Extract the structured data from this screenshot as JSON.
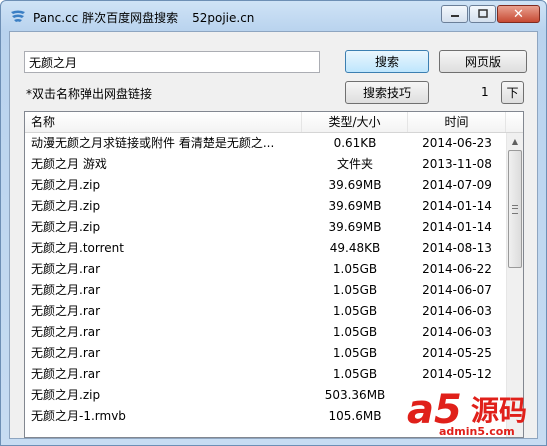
{
  "window": {
    "title": "Panc.cc 胖次百度网盘搜索",
    "subtitle": "52pojie.cn",
    "minimize_icon": "minimize-icon",
    "maximize_icon": "maximize-icon",
    "close_icon": "close-icon"
  },
  "search": {
    "value": "无颜之月",
    "search_button": "搜索",
    "web_button": "网页版",
    "tips_button": "搜索技巧",
    "hint": "*双击名称弹出网盘链接",
    "page": "1",
    "next_button": "下"
  },
  "table": {
    "headers": {
      "name": "名称",
      "type": "类型/大小",
      "time": "时间"
    },
    "rows": [
      {
        "name": "动漫无颜之月求链接或附件 看清楚是无颜之...",
        "size": "0.61KB",
        "time": "2014-06-23"
      },
      {
        "name": "无颜之月 游戏",
        "size": "文件夹",
        "time": "2013-11-08"
      },
      {
        "name": "无颜之月.zip",
        "size": "39.69MB",
        "time": "2014-07-09"
      },
      {
        "name": "无颜之月.zip",
        "size": "39.69MB",
        "time": "2014-01-14"
      },
      {
        "name": "无颜之月.zip",
        "size": "39.69MB",
        "time": "2014-01-14"
      },
      {
        "name": "无颜之月.torrent",
        "size": "49.48KB",
        "time": "2014-08-13"
      },
      {
        "name": "无颜之月.rar",
        "size": "1.05GB",
        "time": "2014-06-22"
      },
      {
        "name": "无颜之月.rar",
        "size": "1.05GB",
        "time": "2014-06-07"
      },
      {
        "name": "无颜之月.rar",
        "size": "1.05GB",
        "time": "2014-06-03"
      },
      {
        "name": "无颜之月.rar",
        "size": "1.05GB",
        "time": "2014-06-03"
      },
      {
        "name": "无颜之月.rar",
        "size": "1.05GB",
        "time": "2014-05-25"
      },
      {
        "name": "无颜之月.rar",
        "size": "1.05GB",
        "time": "2014-05-12"
      },
      {
        "name": "无颜之月.zip",
        "size": "503.36MB",
        "time": ""
      },
      {
        "name": "无颜之月-1.rmvb",
        "size": "105.6MB",
        "time": ""
      }
    ]
  },
  "watermark": {
    "logo": "a5",
    "text": "源码",
    "url": "admin5.com"
  },
  "colors": {
    "title_bar": "#b9d3ee",
    "close_button": "#c74a33",
    "watermark": "#e0201a"
  }
}
